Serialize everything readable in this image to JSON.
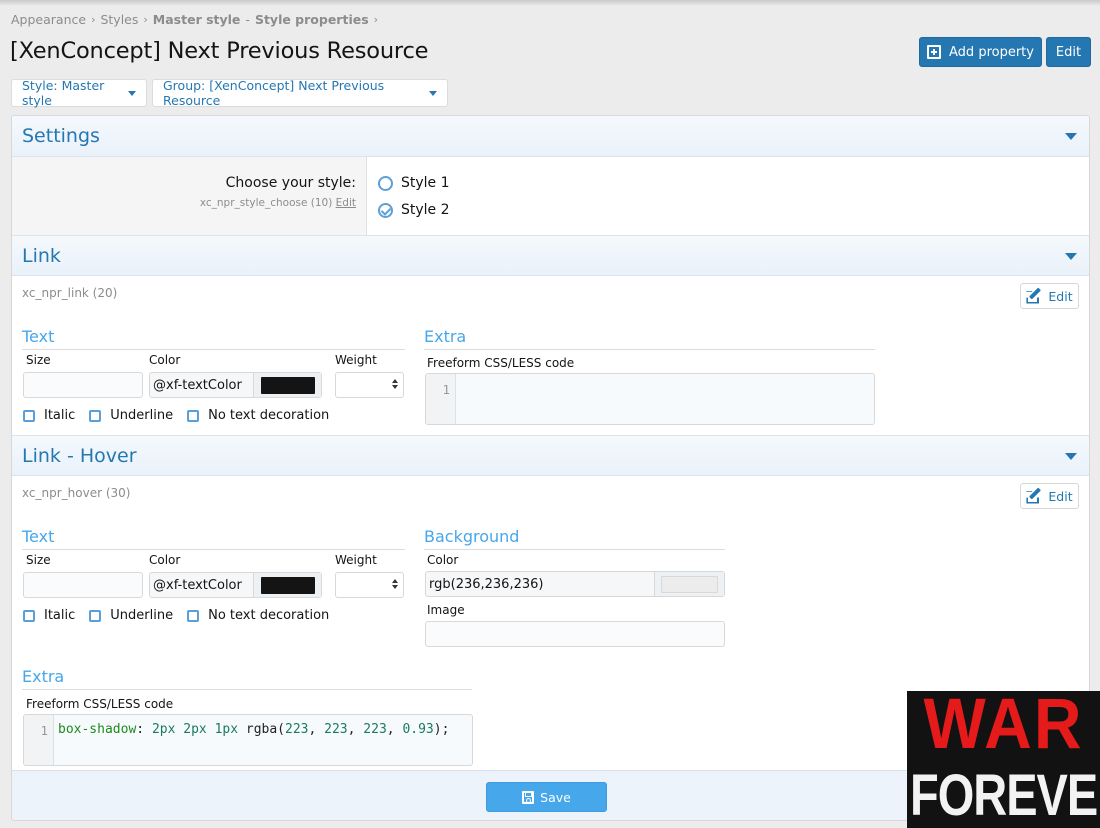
{
  "breadcrumb": [
    {
      "label": "Appearance",
      "strong": false
    },
    {
      "label": "Styles",
      "strong": false
    },
    {
      "label": "Master style",
      "strong": true
    },
    {
      "label": "-",
      "strong": false
    },
    {
      "label": "Style properties",
      "strong": true
    }
  ],
  "breadcrumb_separator": "›",
  "page_title": "[XenConcept] Next Previous Resource",
  "header_buttons": {
    "add_property": "Add property",
    "edit": "Edit"
  },
  "filters": {
    "style": "Style: Master style",
    "group": "Group: [XenConcept] Next Previous Resource"
  },
  "sections": {
    "settings": {
      "title": "Settings",
      "label": "Choose your style:",
      "hint": "xc_npr_style_choose (10)",
      "hint_edit": "Edit",
      "options": [
        {
          "label": "Style 1",
          "checked": false
        },
        {
          "label": "Style 2",
          "checked": true
        }
      ]
    },
    "link": {
      "title": "Link",
      "prop_name": "xc_npr_link (20)",
      "edit_label": "Edit",
      "text_group": {
        "title": "Text",
        "size_label": "Size",
        "size_value": "",
        "color_label": "Color",
        "color_value": "@xf-textColor",
        "color_swatch": "#141414",
        "weight_label": "Weight",
        "weight_value": "",
        "checkboxes": [
          {
            "label": "Italic",
            "checked": false
          },
          {
            "label": "Underline",
            "checked": false
          },
          {
            "label": "No text decoration",
            "checked": false
          }
        ]
      },
      "extra_group": {
        "title": "Extra",
        "code_label": "Freeform CSS/LESS code",
        "line_number": "1",
        "code": ""
      }
    },
    "link_hover": {
      "title": "Link - Hover",
      "prop_name": "xc_npr_hover (30)",
      "edit_label": "Edit",
      "text_group": {
        "title": "Text",
        "size_label": "Size",
        "size_value": "",
        "color_label": "Color",
        "color_value": "@xf-textColor",
        "color_swatch": "#141414",
        "weight_label": "Weight",
        "weight_value": "",
        "checkboxes": [
          {
            "label": "Italic",
            "checked": false
          },
          {
            "label": "Underline",
            "checked": false
          },
          {
            "label": "No text decoration",
            "checked": false
          }
        ]
      },
      "background_group": {
        "title": "Background",
        "color_label": "Color",
        "color_value": "rgb(236,236,236)",
        "color_swatch": "#ececec",
        "image_label": "Image",
        "image_value": ""
      },
      "extra_group": {
        "title": "Extra",
        "code_label": "Freeform CSS/LESS code",
        "line_number": "1",
        "code_tokens": {
          "prop": "box-shadow",
          "colon": ": ",
          "v1": "2px",
          "v2": "2px",
          "v3": "1px",
          "fn": "rgba(",
          "n1": "223",
          "n2": "223",
          "n3": "223",
          "n4": "0.93",
          "end": ");"
        }
      }
    }
  },
  "footer": {
    "save_label": "Save"
  },
  "watermark": {
    "line1": "WAR",
    "line2": "FOREVER"
  },
  "colors": {
    "accent": "#2577b1",
    "accent_light": "#47a7eb",
    "page_bg": "#ececec"
  }
}
